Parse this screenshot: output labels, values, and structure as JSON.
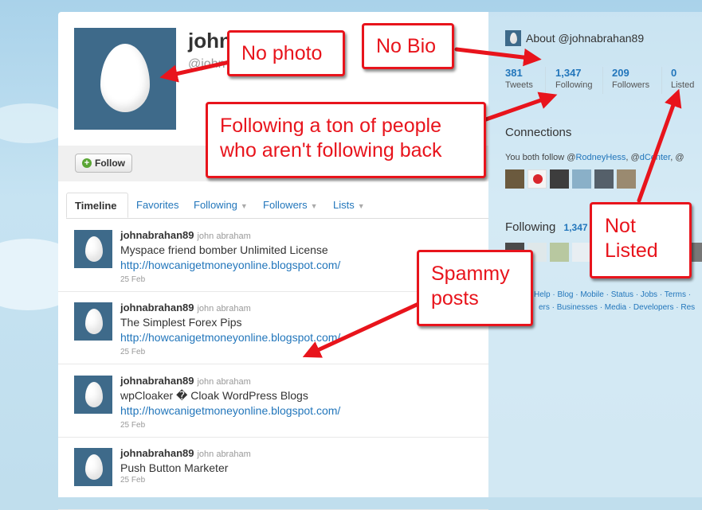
{
  "profile": {
    "name_partial": "john",
    "handle_partial": "@john"
  },
  "actions": {
    "follow_label": "Follow"
  },
  "tabs": [
    {
      "label": "Timeline"
    },
    {
      "label": "Favorites"
    },
    {
      "label": "Following"
    },
    {
      "label": "Followers"
    },
    {
      "label": "Lists"
    }
  ],
  "tweets": [
    {
      "user": "johnabrahan89",
      "real_name": "john abraham",
      "text": "Myspace friend bomber Unlimited License",
      "link": "http://howcanigetmoneyonline.blogspot.com/",
      "time": "25 Feb"
    },
    {
      "user": "johnabrahan89",
      "real_name": "john abraham",
      "text": "The Simplest Forex Pips",
      "link": "http://howcanigetmoneyonline.blogspot.com/",
      "time": "25 Feb"
    },
    {
      "user": "johnabrahan89",
      "real_name": "john abraham",
      "text": "wpCloaker � Cloak WordPress Blogs",
      "link": "http://howcanigetmoneyonline.blogspot.com/",
      "time": "25 Feb"
    },
    {
      "user": "johnabrahan89",
      "real_name": "john abraham",
      "text": "Push Button Marketer",
      "link": "",
      "time": "25 Feb"
    }
  ],
  "sidebar": {
    "about": "About @johnabrahan89",
    "stats": [
      {
        "num": "381",
        "label": "Tweets"
      },
      {
        "num": "1,347",
        "label": "Following"
      },
      {
        "num": "209",
        "label": "Followers"
      },
      {
        "num": "0",
        "label": "Listed"
      }
    ],
    "connections_title": "Connections",
    "both_follow_prefix": "You both follow @",
    "both_follow_user": "RodneyHess",
    "both_follow_sep": ", @",
    "both_follow_user2": "dCenter",
    "both_follow_tail": ", @",
    "following_title": "Following",
    "following_count": "1,347",
    "footer_line1": "Help · Blog · Mobile · Status · Jobs · Terms ·",
    "footer_line2": "ers · Businesses · Media · Developers · Res"
  },
  "callouts": {
    "no_photo": "No photo",
    "no_bio": "No Bio",
    "following_line1": "Following a ton of people",
    "following_line2": "who aren't following back",
    "not_listed_line1": "Not",
    "not_listed_line2": "Listed",
    "spammy_line1": "Spammy",
    "spammy_line2": "posts"
  },
  "colors": {
    "annotation_red": "#e8141c",
    "link_blue": "#2276bb",
    "avatar_bg": "#3e6a8a"
  }
}
